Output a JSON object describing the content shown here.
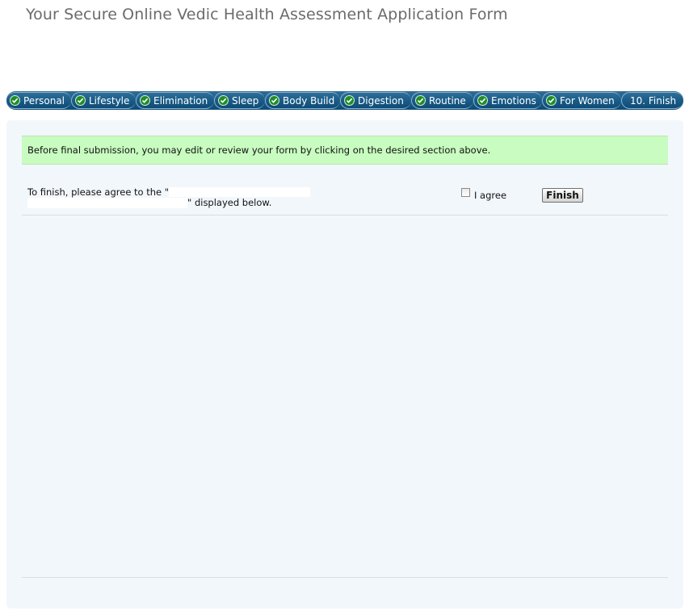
{
  "page": {
    "title": "Your Secure Online Vedic Health Assessment Application Form"
  },
  "steps": [
    {
      "label": "Personal",
      "icon": "check-circle-icon",
      "completed": true
    },
    {
      "label": "Lifestyle",
      "icon": "check-circle-icon",
      "completed": true
    },
    {
      "label": "Elimination",
      "icon": "check-circle-icon",
      "completed": true
    },
    {
      "label": "Sleep",
      "icon": "check-circle-icon",
      "completed": true
    },
    {
      "label": "Body Build",
      "icon": "check-circle-icon",
      "completed": true
    },
    {
      "label": "Digestion",
      "icon": "check-circle-icon",
      "completed": true
    },
    {
      "label": "Routine",
      "icon": "check-circle-icon",
      "completed": true
    },
    {
      "label": "Emotions",
      "icon": "check-circle-icon",
      "completed": true
    },
    {
      "label": "For Women",
      "icon": "check-circle-icon",
      "completed": true
    },
    {
      "label": "10. Finish",
      "completed": false
    }
  ],
  "notice": {
    "text": "Before final submission, you may edit or review your form by clicking on the desired section above."
  },
  "agreement": {
    "prefix": "To finish, please agree to the \"",
    "suffix": "\" displayed below.",
    "checkbox_label": "I agree",
    "checked": false,
    "finish_label": "Finish"
  },
  "colors": {
    "stepbar": "#185a86",
    "check": "#1f8d2a",
    "notice_bg": "#c8fcc0",
    "panel_bg": "#f2f7fc"
  }
}
